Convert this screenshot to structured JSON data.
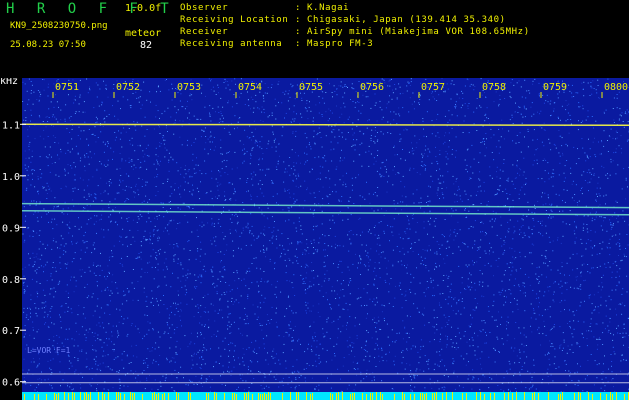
{
  "header": {
    "brand": "H R O F F T",
    "version": "1.0.0f",
    "filename": "KN9_2508230750.png",
    "datetime": "25.08.23 07:50",
    "meteor_label": "meteor",
    "meteor_count": "82"
  },
  "meta": [
    {
      "label": "Observer",
      "value": ": K.Nagai"
    },
    {
      "label": "Receiving Location",
      "value": ": Chigasaki, Japan (139.414 35.340)"
    },
    {
      "label": "Receiver",
      "value": ": AirSpy mini (Miakejima VOR 108.65MHz)"
    },
    {
      "label": "Receiving antenna",
      "value": ": Maspro FM-3"
    }
  ],
  "colors": {
    "background": "#0a1aa0",
    "noise": "#2a6aff",
    "signal_line": "#7fffd0",
    "top_line": "#ffff40",
    "header_green": "#22d04a",
    "header_yellow": "#f0f000",
    "bottom_bar": "#00e5ff"
  },
  "chart_data": {
    "type": "heatmap",
    "y_unit": "kHz",
    "x_ticks": [
      "0751",
      "0752",
      "0753",
      "0754",
      "0755",
      "0756",
      "0757",
      "0758",
      "0759",
      "0800"
    ],
    "y_ticks": [
      "1.1",
      "1.0",
      "0.9",
      "0.8",
      "0.7",
      "0.6"
    ],
    "y_tick_values": [
      1.1,
      1.0,
      0.9,
      0.8,
      0.7,
      0.6
    ],
    "ylim": [
      0.58,
      1.19
    ],
    "xlim_minutes": [
      0,
      10
    ],
    "horizontal_signals_khz": [
      1.1,
      0.946,
      0.932
    ],
    "reference_lines_khz": [
      0.615,
      0.598
    ],
    "overlay_text": "L=VOR F=1"
  }
}
